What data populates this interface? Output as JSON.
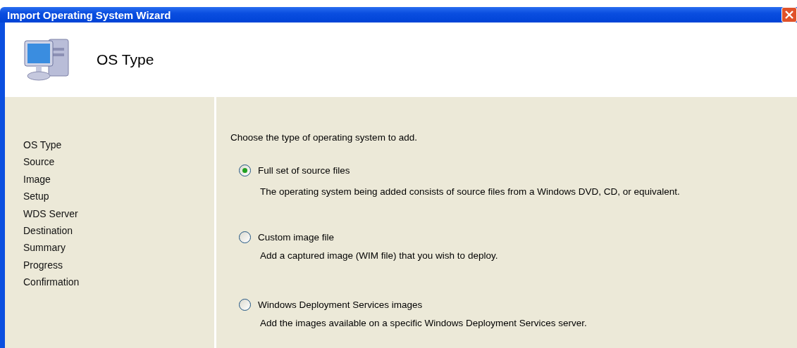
{
  "window": {
    "title": "Import Operating System Wizard"
  },
  "header": {
    "title": "OS Type"
  },
  "steps": [
    "OS Type",
    "Source",
    "Image",
    "Setup",
    "WDS Server",
    "Destination",
    "Summary",
    "Progress",
    "Confirmation"
  ],
  "prompt": "Choose the type of operating system to add.",
  "options": [
    {
      "label": "Full set of source files",
      "description": "The operating system being added consists of source files from a Windows DVD, CD, or equivalent.",
      "selected": true
    },
    {
      "label": "Custom image file",
      "description": "Add a captured image (WIM file) that you wish to deploy.",
      "selected": false
    },
    {
      "label": "Windows Deployment Services images",
      "description": "Add the images available on a specific Windows Deployment Services server.",
      "selected": false
    }
  ]
}
